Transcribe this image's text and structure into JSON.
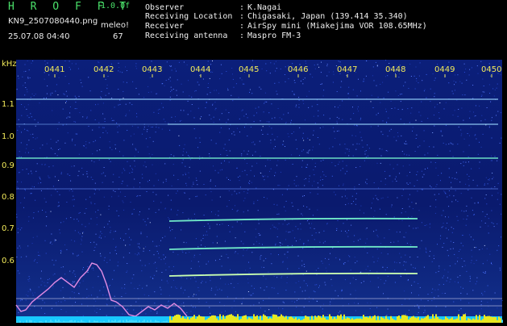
{
  "header": {
    "app_title": "H R O F F T",
    "version": "1.0.0f",
    "filename": "KN9_2507080440.png",
    "meleo_label": "meleo!",
    "timestamp": "25.07.08 04:40",
    "meleo_value": "67",
    "info": [
      {
        "key": "Observer",
        "value": "K.Nagai"
      },
      {
        "key": "Receiving Location",
        "value": "Chigasaki, Japan (139.414 35.340)"
      },
      {
        "key": "Receiver",
        "value": "AirSpy mini (Miakejima VOR 108.65MHz)"
      },
      {
        "key": "Receiving antenna",
        "value": "Maspro FM-3"
      }
    ]
  },
  "chart_data": {
    "type": "heatmap",
    "y_unit": "kHz",
    "y_ticks": [
      "1.1",
      "1.0",
      "0.9",
      "0.8",
      "0.7",
      "0.6"
    ],
    "x_ticks": [
      "0441",
      "0442",
      "0443",
      "0444",
      "0445",
      "0446",
      "0447",
      "0448",
      "0449",
      "0450"
    ],
    "colors": {
      "background": "#0a1a6e",
      "trace": "#70e8c8",
      "profile": "#d070d8",
      "baseline": "#18c8ff",
      "bursts": "#e8e820",
      "axis": "#f2ea5a"
    }
  }
}
